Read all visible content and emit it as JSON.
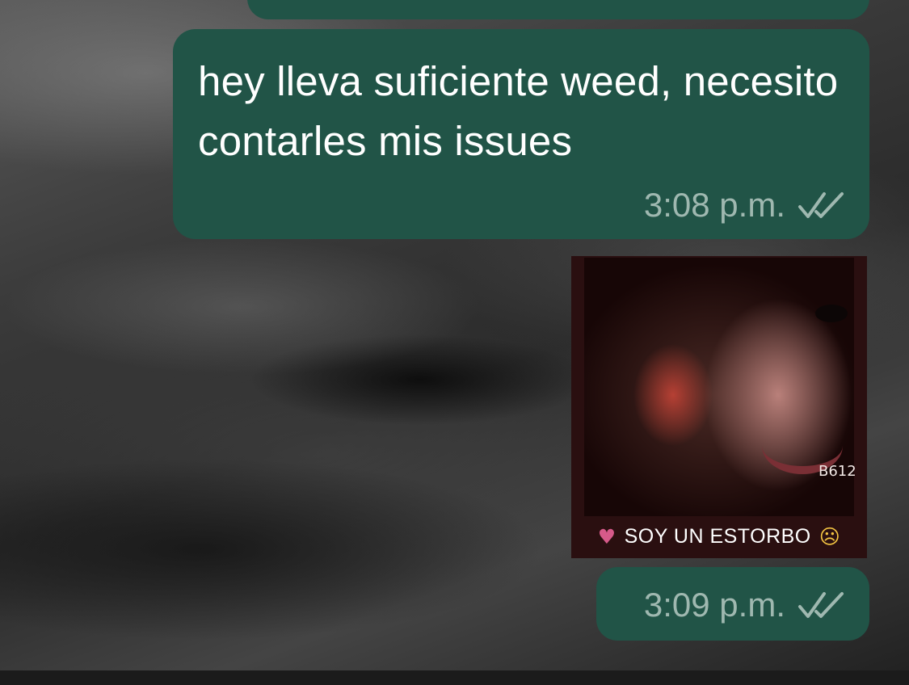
{
  "messages": [
    {
      "text": "hey lleva suficiente weed, necesito contarles mis issues",
      "time": "3:08 p.m.",
      "ticks_icon": "double-check-icon"
    },
    {
      "sticker": {
        "badge": "B612",
        "caption": "SOY UN ESTORBO",
        "caption_left_icon": "broken-heart-icon",
        "caption_right_icon": "crying-face-icon"
      },
      "time": "3:09 p.m.",
      "ticks_icon": "double-check-icon"
    }
  ],
  "colors": {
    "outgoing_bubble": "#215447",
    "meta_text": "#9fb8b0"
  }
}
